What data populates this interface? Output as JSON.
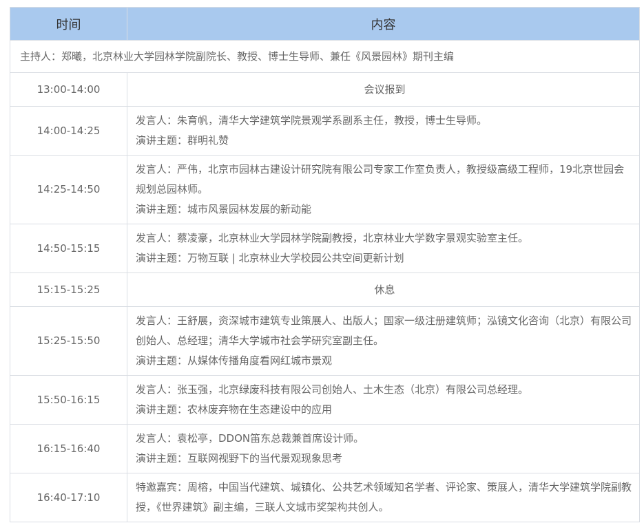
{
  "header": {
    "time": "时间",
    "content": "内容"
  },
  "host": "主持人：郑曦，北京林业大学园林学院副院长、教授、博士生导师、兼任《风景园林》期刊主编",
  "rows": [
    {
      "time": "13:00-14:00",
      "lines": [
        "会议报到"
      ]
    },
    {
      "time": "14:00-14:25",
      "lines": [
        "发言人：朱育帆，清华大学建筑学院景观学系副系主任，教授，博士生导师。",
        "演讲主题：群明礼赞"
      ]
    },
    {
      "time": "14:25-14:50",
      "lines": [
        "发言人：严伟，北京市园林古建设计研究院有限公司专家工作室负责人，教授级高级工程师，19北京世园会规划总园林师。",
        "演讲主题：城市风景园林发展的新动能"
      ]
    },
    {
      "time": "14:50-15:15",
      "lines": [
        "发言人：蔡凌豪，北京林业大学园林学院副教授，北京林业大学数字景观实验室主任。",
        "演讲主题：万物互联 | 北京林业大学校园公共空间更新计划"
      ]
    },
    {
      "time": "15:15-15:25",
      "lines": [
        "休息"
      ]
    },
    {
      "time": "15:25-15:50",
      "lines": [
        "发言人：王舒展，资深城市建筑专业策展人、出版人；国家一级注册建筑师；泓镜文化咨询（北京）有限公司创始人、总经理；清华大学城市社会学研究室副主任。",
        "演讲主题：从媒体传播角度看网红城市景观"
      ]
    },
    {
      "time": "15:50-16:15",
      "lines": [
        "发言人：张玉强，北京绿废科技有限公司创始人、土木生态（北京）有限公司总经理。",
        "演讲主题：农林废弃物在生态建设中的应用"
      ]
    },
    {
      "time": "16:15-16:40",
      "lines": [
        "发言人：袁松亭，DDON笛东总裁兼首席设计师。",
        "演讲主题：互联网视野下的当代景观现象思考"
      ]
    },
    {
      "time": "16:40-17:10",
      "lines": [
        "特邀嘉宾：周榕，中国当代建筑、城镇化、公共艺术领域知名学者、评论家、策展人，清华大学建筑学院副教授，《世界建筑》副主编，三联人文城市奖架构共创人。"
      ]
    }
  ]
}
